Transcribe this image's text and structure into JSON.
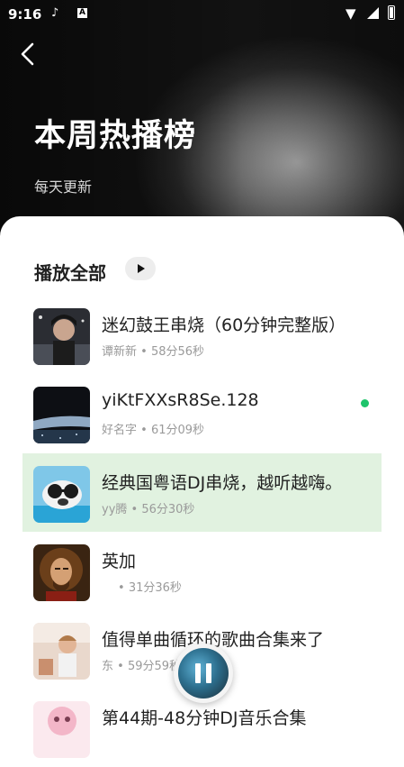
{
  "status_bar": {
    "time": "9:16",
    "app_icons": [
      "tiktok-icon",
      "a-icon"
    ],
    "app_badge": "A",
    "right_icons": [
      "wifi-icon",
      "signal-icon",
      "battery-icon"
    ]
  },
  "header": {
    "title": "本周热播榜",
    "subtitle": "每天更新"
  },
  "list": {
    "play_all_label": "播放全部",
    "songs": [
      {
        "title": "迷幻鼓王串烧（60分钟完整版）",
        "artist": "谭新新",
        "duration": "58分56秒"
      },
      {
        "title": "yiKtFXXsR8Se.128",
        "artist": "好名字",
        "duration": "61分09秒"
      },
      {
        "title": "经典国粤语DJ串烧，越听越嗨。",
        "artist": "yy腾",
        "duration": "56分30秒"
      },
      {
        "title": "英加",
        "artist": "",
        "duration": "31分36秒"
      },
      {
        "title": "值得单曲循环的歌曲合集来了",
        "artist": "东",
        "duration": "59分59秒"
      },
      {
        "title": "第44期-48分钟DJ音乐合集",
        "artist": "",
        "duration": ""
      }
    ],
    "meta_separator": " • ",
    "active_index": 2
  },
  "colors": {
    "active_row": "#e1f2e0",
    "indicator_dot": "#1ec46b"
  }
}
